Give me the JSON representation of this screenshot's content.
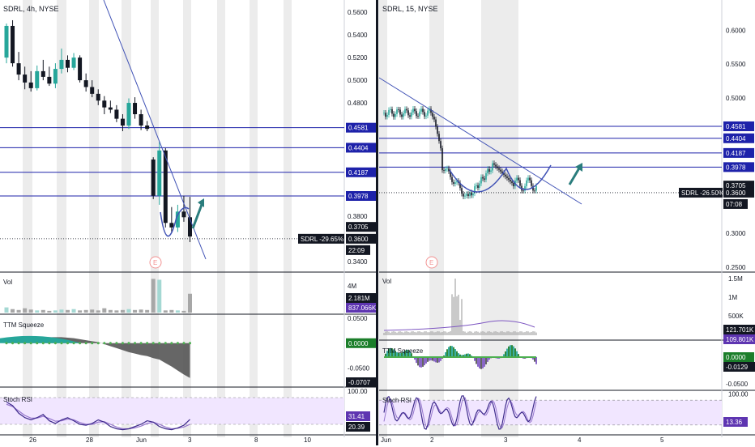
{
  "colors": {
    "up": "#26a69a",
    "down": "#131722",
    "level_line": "#1e22aa",
    "trend_line": "#3f51b5",
    "arrow": "#2a7d7d",
    "stoch_band": "#f1e6ff",
    "stoch_k": "#3e2b8c",
    "stoch_d": "#9575cd",
    "vol_bar": "#a7a7a7",
    "squeeze_pos": "#26a69a",
    "squeeze_neg": "#555555",
    "squeeze_neg_light": "#7e57c2",
    "squeeze_dot": "#4caf50",
    "session_shade": "#ececec",
    "last_price_tag": "#131722",
    "earnings_marker": "#f29494",
    "separator": "#131722"
  },
  "chart_data": [
    {
      "id": "left",
      "type": "candlestick",
      "title": "SDRL, 4h, NYSE",
      "symbol": "SDRL",
      "interval": "4h",
      "exchange": "NYSE",
      "ylim": [
        0.332,
        0.568
      ],
      "y_ticks": [
        "0.5600",
        "0.5400",
        "0.5200",
        "0.5000",
        "0.4800",
        "0.3800",
        "0.3400"
      ],
      "y_tick_values": [
        0.56,
        0.54,
        0.52,
        0.5,
        0.48,
        0.38,
        0.34
      ],
      "levels": [
        {
          "value": 0.4581,
          "label": "0.4581"
        },
        {
          "value": 0.4404,
          "label": "0.4404"
        },
        {
          "value": 0.4187,
          "label": "0.4187"
        },
        {
          "value": 0.3978,
          "label": "0.3978"
        }
      ],
      "level_0_3705": "0.3705",
      "last_price": 0.36,
      "last_price_label": "0.3600",
      "last_tag": "SDRL -29.65%",
      "countdown": "22:09",
      "candles": [
        [
          0.52,
          0.55,
          0.515,
          0.548
        ],
        [
          0.548,
          0.553,
          0.512,
          0.515
        ],
        [
          0.515,
          0.525,
          0.5,
          0.505
        ],
        [
          0.505,
          0.512,
          0.492,
          0.498
        ],
        [
          0.498,
          0.508,
          0.49,
          0.493
        ],
        [
          0.493,
          0.513,
          0.491,
          0.508
        ],
        [
          0.508,
          0.518,
          0.5,
          0.503
        ],
        [
          0.503,
          0.512,
          0.495,
          0.497
        ],
        [
          0.497,
          0.515,
          0.493,
          0.51
        ],
        [
          0.51,
          0.528,
          0.506,
          0.518
        ],
        [
          0.518,
          0.522,
          0.507,
          0.511
        ],
        [
          0.511,
          0.524,
          0.509,
          0.52
        ],
        [
          0.52,
          0.522,
          0.498,
          0.5
        ],
        [
          0.5,
          0.506,
          0.49,
          0.494
        ],
        [
          0.494,
          0.5,
          0.485,
          0.488
        ],
        [
          0.488,
          0.492,
          0.478,
          0.482
        ],
        [
          0.482,
          0.486,
          0.47,
          0.476
        ],
        [
          0.476,
          0.482,
          0.471,
          0.474
        ],
        [
          0.474,
          0.478,
          0.463,
          0.466
        ],
        [
          0.466,
          0.47,
          0.455,
          0.46
        ],
        [
          0.46,
          0.484,
          0.457,
          0.48
        ],
        [
          0.48,
          0.485,
          0.466,
          0.47
        ],
        [
          0.47,
          0.474,
          0.456,
          0.46
        ],
        [
          0.46,
          0.464,
          0.455,
          0.457
        ],
        [
          0.43,
          0.432,
          0.395,
          0.398
        ],
        [
          0.398,
          0.446,
          0.39,
          0.438
        ],
        [
          0.438,
          0.44,
          0.37,
          0.374
        ],
        [
          0.374,
          0.388,
          0.365,
          0.37
        ],
        [
          0.37,
          0.39,
          0.366,
          0.384
        ],
        [
          0.384,
          0.398,
          0.375,
          0.379
        ],
        [
          0.379,
          0.397,
          0.357,
          0.362
        ]
      ],
      "volume": {
        "label": "Vol",
        "ticks": [
          "4M"
        ],
        "max": 4500000,
        "values": [
          600000,
          400000,
          300000,
          500000,
          350000,
          250000,
          300000,
          200000,
          250000,
          350000,
          300000,
          400000,
          250000,
          300000,
          350000,
          250000,
          500000,
          300000,
          250000,
          300000,
          400000,
          300000,
          350000,
          300000,
          3900000,
          3800000,
          250000,
          300000,
          250000,
          200000,
          2181000
        ],
        "value_labels": [
          "2.181M",
          "837.066K"
        ]
      },
      "squeeze": {
        "label": "TTM Squeeze",
        "ticks": [
          "0.0500",
          "-0.0500"
        ],
        "ylim": [
          -0.085,
          0.055
        ],
        "value_labels": [
          "0.0000",
          "-0.0707"
        ],
        "values": [
          0.0,
          0.004,
          0.006,
          0.008,
          0.01,
          0.011,
          0.012,
          0.012,
          0.012,
          0.012,
          0.011,
          0.01,
          0.008,
          0.006,
          0.004,
          0.002,
          -0.002,
          -0.006,
          -0.01,
          -0.014,
          -0.018,
          -0.021,
          -0.024,
          -0.026,
          -0.03,
          -0.033,
          -0.04,
          -0.047,
          -0.055,
          -0.063,
          -0.07
        ]
      },
      "stoch": {
        "label": "Stoch RSI",
        "ticks": [
          "100.00"
        ],
        "value_labels": [
          "31.41",
          "20.39"
        ],
        "k": [
          70,
          62,
          45,
          35,
          30,
          35,
          42,
          28,
          22,
          30,
          35,
          28,
          20,
          18,
          22,
          30,
          25,
          15,
          10,
          8,
          10,
          15,
          20,
          28,
          25,
          15,
          10,
          8,
          12,
          18,
          31
        ],
        "d": [
          65,
          60,
          50,
          40,
          34,
          34,
          38,
          33,
          27,
          28,
          32,
          30,
          24,
          20,
          20,
          25,
          26,
          20,
          14,
          10,
          10,
          12,
          16,
          22,
          25,
          20,
          14,
          10,
          11,
          14,
          20
        ]
      },
      "x_ticks": [
        "26",
        "28",
        "Jun",
        "8",
        "10"
      ],
      "x_tick_extra": "3",
      "earnings": "E"
    },
    {
      "id": "right",
      "type": "candlestick",
      "title": "SDRL, 15, NYSE",
      "symbol": "SDRL",
      "interval": "15",
      "exchange": "NYSE",
      "ylim": [
        0.245,
        0.64
      ],
      "y_ticks": [
        "0.6000",
        "0.5500",
        "0.5000",
        "0.3000",
        "0.2500"
      ],
      "y_tick_values": [
        0.6,
        0.55,
        0.5,
        0.3,
        0.25
      ],
      "levels": [
        {
          "value": 0.4581,
          "label": "0.4581"
        },
        {
          "value": 0.4404,
          "label": "0.4404"
        },
        {
          "value": 0.4187,
          "label": "0.4187"
        },
        {
          "value": 0.3978,
          "label": "0.3978"
        }
      ],
      "level_0_3705": "0.3705",
      "last_price": 0.36,
      "last_price_label": "0.3600",
      "last_tag": "SDRL -26.50%",
      "countdown": "07:08",
      "volume": {
        "label": "Vol",
        "ticks": [
          "1.5M",
          "1M",
          "500K"
        ],
        "value_labels": [
          "121.701K",
          "109.801K"
        ]
      },
      "squeeze": {
        "label": "TTM Squeeze",
        "ticks": [
          "-0.0500"
        ],
        "value_labels": [
          "0.0000",
          "-0.0129"
        ]
      },
      "stoch": {
        "label": "Stoch RSI",
        "ticks": [
          "100.00"
        ],
        "value_labels": [
          "13.36"
        ]
      },
      "x_ticks": [
        "Jun",
        "2",
        "3",
        "4",
        "5"
      ],
      "earnings": "E"
    }
  ]
}
